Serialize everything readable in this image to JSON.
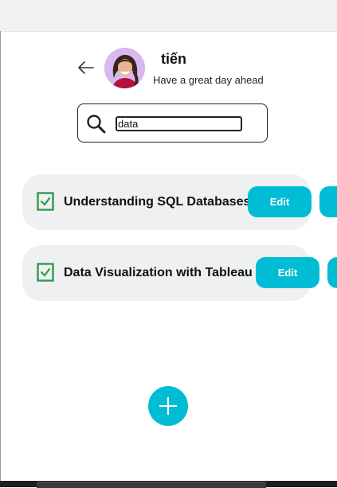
{
  "header": {
    "username": "tiến",
    "greeting": "Have a great day ahead"
  },
  "search": {
    "value": "data",
    "placeholder": ""
  },
  "tasks": [
    {
      "title": "Understanding SQL Databases",
      "completed": true,
      "edit_label": "Edit",
      "delete_label": ""
    },
    {
      "title": "Data Visualization with Tableau",
      "completed": true,
      "edit_label": "Edit",
      "delete_label": ""
    }
  ],
  "colors": {
    "accent": "#00bcd4",
    "check": "#2e9b4f",
    "card": "#eff0f2"
  },
  "icons": {
    "back": "arrow-left-icon",
    "search": "magnifier-icon",
    "checkbox": "checked-box-icon",
    "add": "plus-icon"
  }
}
